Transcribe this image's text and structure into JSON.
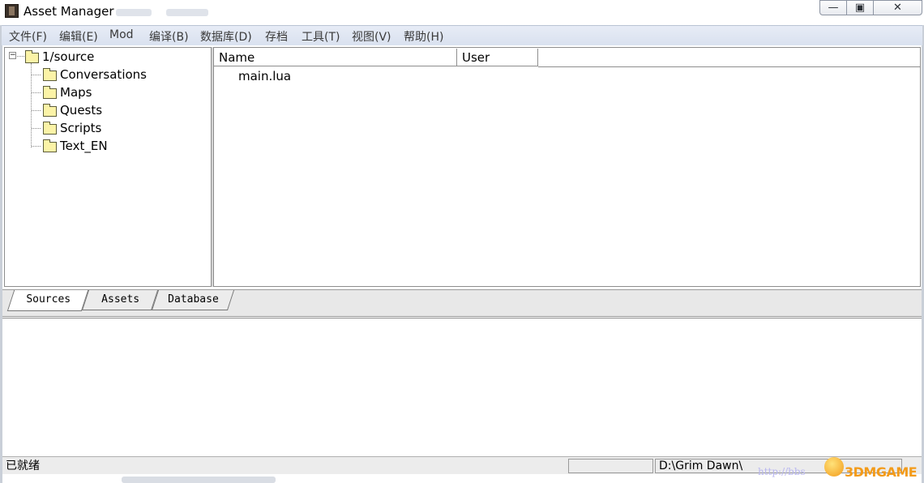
{
  "window": {
    "title": "Asset Manager",
    "controls": {
      "minimize": "—",
      "maximize": "▣",
      "close": "✕"
    }
  },
  "menu": [
    "文件(F)",
    "编辑(E)",
    "Mod",
    "编译(B)",
    "数据库(D)",
    "存档",
    "工具(T)",
    "视图(V)",
    "帮助(H)"
  ],
  "tree": {
    "root": "1/source",
    "expander": "−",
    "children": [
      "Conversations",
      "Maps",
      "Quests",
      "Scripts",
      "Text_EN"
    ]
  },
  "list": {
    "columns": [
      "Name",
      "User"
    ],
    "rows": [
      {
        "name": "main.lua",
        "user": ""
      }
    ]
  },
  "tabs": [
    "Sources",
    "Assets",
    "Database"
  ],
  "status": {
    "text": "已就绪",
    "cell2": "",
    "path": "D:\\Grim Dawn\\"
  },
  "watermark": {
    "url": "http://bbs",
    "logo": "3DMGAME"
  },
  "colors": {
    "menubar": "#dfe6f2",
    "folder": "#fbf3a7",
    "accent": "#f39b1a"
  }
}
